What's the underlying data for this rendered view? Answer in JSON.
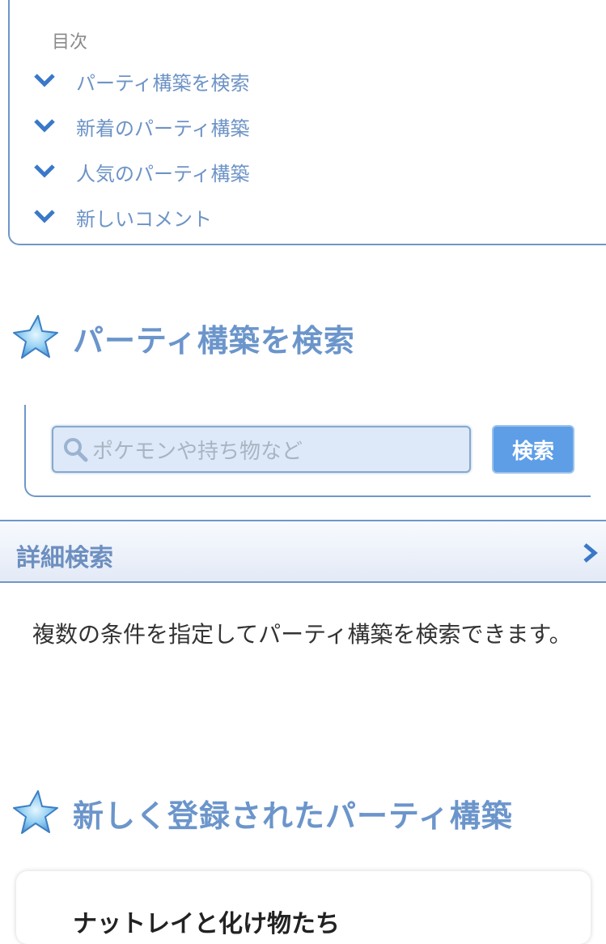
{
  "toc": {
    "title": "目次",
    "items": [
      {
        "label": "パーティ構築を検索"
      },
      {
        "label": "新着のパーティ構築"
      },
      {
        "label": "人気のパーティ構築"
      },
      {
        "label": "新しいコメント"
      }
    ]
  },
  "search_section": {
    "heading": "パーティ構築を検索",
    "placeholder": "ポケモンや持ち物など",
    "button_label": "検索"
  },
  "detail_search": {
    "label": "詳細検索",
    "description": "複数の条件を指定してパーティ構築を検索できます。"
  },
  "new_section": {
    "heading": "新しく登録されたパーティ構築",
    "first_card_title": "ナットレイと化け物たち"
  },
  "colors": {
    "accent": "#6b95cb",
    "button": "#5d9ee6",
    "input_bg": "#dde9f9"
  }
}
